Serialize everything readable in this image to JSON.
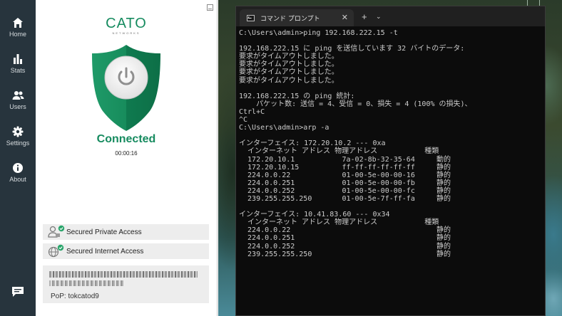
{
  "cato": {
    "brand_name": "CATO",
    "brand_sub": "NETWORKS",
    "status": "Connected",
    "uptime": "00:00:16",
    "nav": [
      {
        "label": "Home",
        "icon": "home-icon"
      },
      {
        "label": "Stats",
        "icon": "bar-chart-icon"
      },
      {
        "label": "Users",
        "icon": "users-icon"
      },
      {
        "label": "Settings",
        "icon": "gear-icon"
      },
      {
        "label": "About",
        "icon": "info-icon"
      }
    ],
    "access": [
      {
        "label": "Secured Private Access",
        "icon": "private-access-icon",
        "status_color": "#2aa56b"
      },
      {
        "label": "Secured Internet Access",
        "icon": "globe-icon",
        "status_color": "#2aa56b"
      }
    ],
    "pop": "PoP: tokcatod9",
    "colors": {
      "accent": "#168b5f",
      "sidebar": "#27343d"
    }
  },
  "cmd": {
    "tab_title": "コマンド プロンプト",
    "new_tab": "+",
    "dropdown": "⌄",
    "close": "✕",
    "lines": [
      "C:\\Users\\admin>ping 192.168.222.15 -t",
      "",
      "192.168.222.15 に ping を送信しています 32 バイトのデータ:",
      "要求がタイムアウトしました。",
      "要求がタイムアウトしました。",
      "要求がタイムアウトしました。",
      "要求がタイムアウトしました。",
      "",
      "192.168.222.15 の ping 統計:",
      "    パケット数: 送信 = 4、受信 = 0、損失 = 4 (100% の損失)、",
      "Ctrl+C",
      "^C",
      "C:\\Users\\admin>arp -a",
      "",
      "インターフェイス: 172.20.10.2 --- 0xa",
      "  インターネット アドレス 物理アドレス           種類",
      "  172.20.10.1           7a-02-8b-32-35-64     動的",
      "  172.20.10.15          ff-ff-ff-ff-ff-ff     静的",
      "  224.0.0.22            01-00-5e-00-00-16     静的",
      "  224.0.0.251           01-00-5e-00-00-fb     静的",
      "  224.0.0.252           01-00-5e-00-00-fc     静的",
      "  239.255.255.250       01-00-5e-7f-ff-fa     静的",
      "",
      "インターフェイス: 10.41.83.60 --- 0x34",
      "  インターネット アドレス 物理アドレス           種類",
      "  224.0.0.22                                  静的",
      "  224.0.0.251                                 静的",
      "  224.0.0.252                                 静的",
      "  239.255.255.250                             静的"
    ]
  }
}
